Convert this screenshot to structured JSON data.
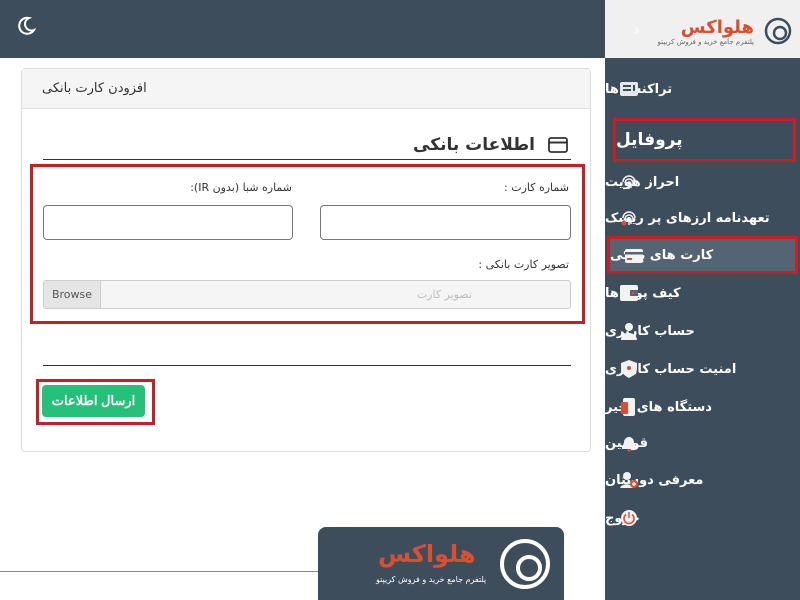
{
  "topbar": {
    "theme_icon": "moon-icon"
  },
  "brand": {
    "name": "هلواکس",
    "tagline": "پلتفرم جامع خرید و فروش کریپتو",
    "collapse": "‹",
    "logo_icon": "hellowax-logo-icon"
  },
  "sidebar": {
    "items": [
      {
        "label": "تراکنش ها",
        "icon": "transactions-icon"
      },
      {
        "label": "پروفایل",
        "icon": ""
      },
      {
        "label": "احراز هویت",
        "icon": "fingerprint-icon"
      },
      {
        "label": "تعهدنامه ارزهای پر ریسک",
        "icon": "fingerprint-icon"
      },
      {
        "label": "کارت های بانکی",
        "icon": "card-icon"
      },
      {
        "label": "کیف پول ها",
        "icon": "wallet-icon"
      },
      {
        "label": "حساب کاربری",
        "icon": "user-icon"
      },
      {
        "label": "امنیت حساب کاربری",
        "icon": "shield-icon"
      },
      {
        "label": "دستگاه های اخیر",
        "icon": "devices-icon"
      },
      {
        "label": "قوانین",
        "icon": "bell-icon"
      },
      {
        "label": "معرفی دوستان",
        "icon": "add-user-icon"
      },
      {
        "label": "خروج",
        "icon": "power-icon"
      }
    ],
    "active_index": 4
  },
  "card": {
    "header": "افزودن کارت بانکی",
    "section_title": "اطلاعات بانکی",
    "card_number_label": "شماره کارت :",
    "sheba_label": "شماره شبا (بدون IR):",
    "card_image_label": "تصویر کارت بانکی :",
    "browse_label": "Browse",
    "file_placeholder": "تصویر کارت",
    "submit_label": "ارسال اطلاعات"
  },
  "watermark": {
    "name": "هلواکس",
    "tagline": "پلتفرم جامع خرید و فروش کریپتو"
  },
  "colors": {
    "sidebar": "#3d4d5c",
    "highlight": "#c62026",
    "accent": "#27c07b",
    "brand": "#d8502f"
  }
}
